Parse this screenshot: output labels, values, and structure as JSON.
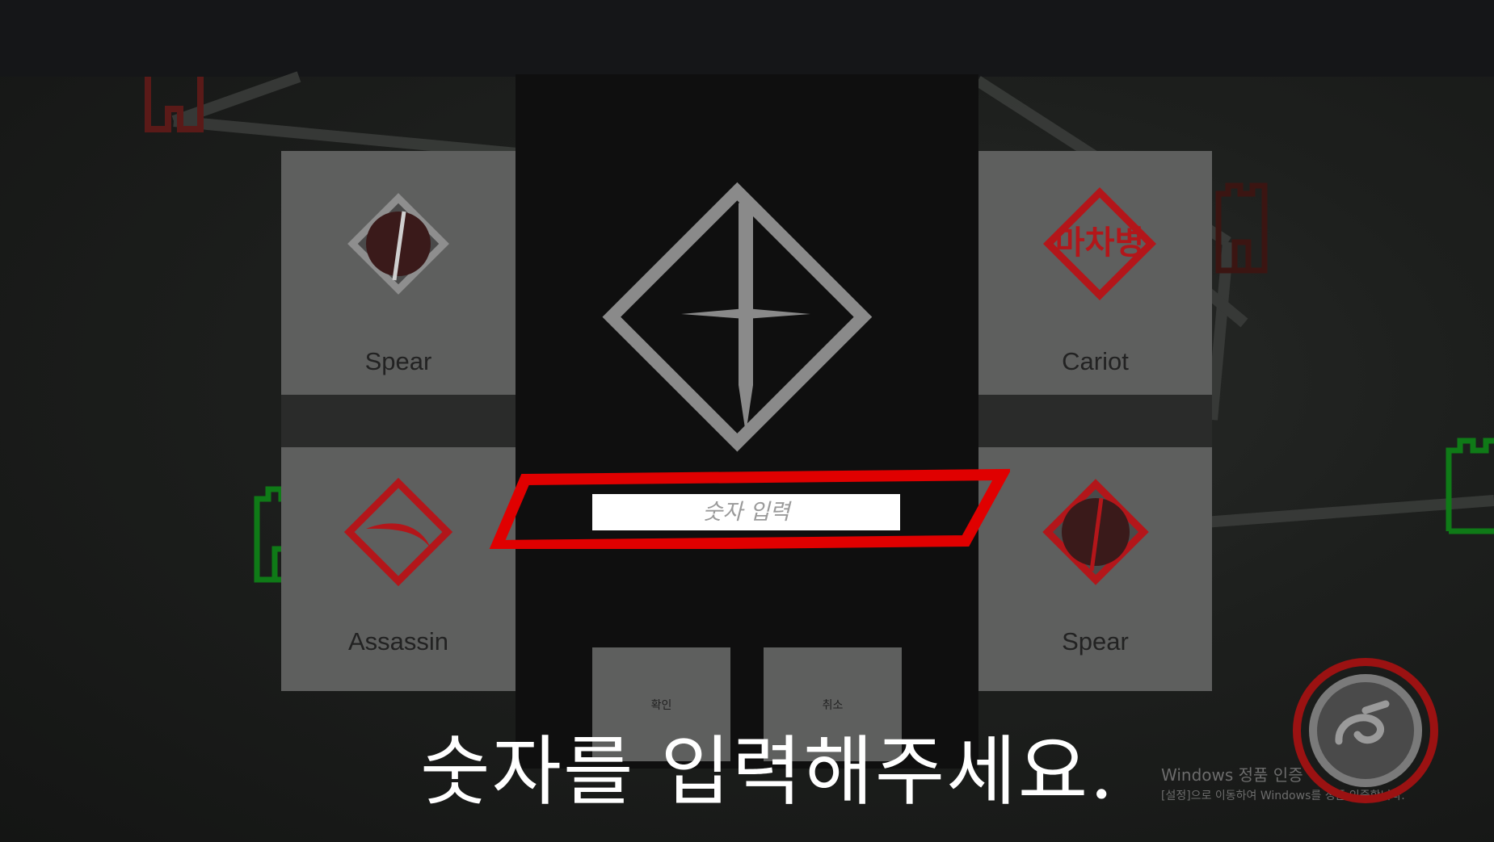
{
  "cards": {
    "top_left": {
      "label": "Spear"
    },
    "bottom_left": {
      "label": "Assassin"
    },
    "top_right": {
      "label": "Cariot",
      "icon_text": "마차병"
    },
    "bottom_right": {
      "label": "Spear"
    }
  },
  "modal": {
    "icon": "sword-diamond-icon",
    "input_placeholder": "숫자 입력",
    "input_value": "",
    "confirm_label": "확인",
    "cancel_label": "취소"
  },
  "subtitle": "숫자를 입력해주세요.",
  "watermark": {
    "title": "Windows 정품 인증",
    "subtitle": "[설정]으로 이동하여 Windows를 정품 인증합니다."
  },
  "icons": {
    "refresh": "refresh-icon",
    "castle": "castle-icon"
  },
  "colors": {
    "accent_red": "#e00000",
    "icon_red": "#b3161a",
    "card_gray": "#5e5f5e",
    "castle_green": "#0f8a1a"
  }
}
